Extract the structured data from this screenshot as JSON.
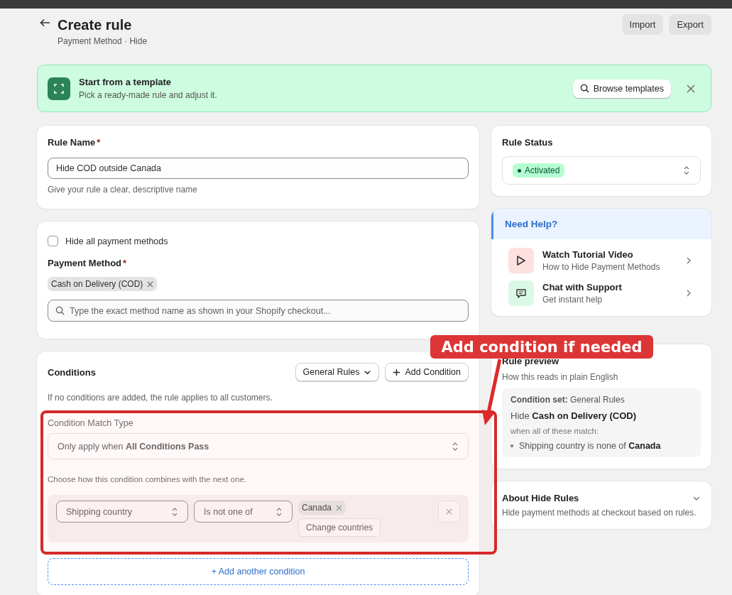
{
  "header": {
    "title": "Create rule",
    "subtitle": "Payment Method · Hide",
    "actions": [
      "Import",
      "Export"
    ]
  },
  "template_banner": {
    "title": "Start from a template",
    "description": "Pick a ready-made rule and adjust it.",
    "button": "Browse templates"
  },
  "rule_name": {
    "label": "Rule Name",
    "required_mark": "*",
    "value": "Hide COD outside Canada",
    "hint": "Give your rule a clear, descriptive name"
  },
  "payment": {
    "hide_all": {
      "label": "Hide all payment methods",
      "checked": false
    },
    "label": "Payment Method",
    "required_mark": "*",
    "chips": [
      "Cash on Delivery (COD)"
    ],
    "search": {
      "placeholder": "Type the exact method name as shown in your Shopify checkout..."
    }
  },
  "conditions": {
    "title": "Conditions",
    "set_button": "General Rules",
    "add_button": "Add Condition",
    "note": "If no conditions are added, the rule applies to all customers.",
    "match_label": "Condition Match Type",
    "match_value": "Only apply when **All Conditions Pass**",
    "match_hint": "Choose how this condition combines with the next one.",
    "rows": [
      {
        "field": "Shipping country",
        "operator": "Is not one of",
        "values": [
          "Canada"
        ],
        "change_button": "Change countries"
      }
    ],
    "add_another": "+ Add another condition"
  },
  "status": {
    "title": "Rule Status",
    "value": "Activated"
  },
  "help": {
    "title": "Need Help?",
    "items": [
      {
        "kind": "video",
        "title": "Watch Tutorial Video",
        "subtitle": "How to Hide Payment Methods"
      },
      {
        "kind": "chat",
        "title": "Chat with Support",
        "subtitle": "Get instant help"
      }
    ]
  },
  "preview": {
    "title": "Rule preview",
    "subtitle": "How this reads in plain English",
    "set": "**Condition set:** General Rules",
    "action": "Hide **Cash on Delivery (COD)**",
    "when": "when all of these match:",
    "items": [
      "Shipping country is none of **Canada**"
    ]
  },
  "about": {
    "title": "About Hide Rules",
    "description": "Hide payment methods at checkout based on rules.",
    "expanded": false
  },
  "annotation": {
    "label": "Add condition if needed"
  }
}
